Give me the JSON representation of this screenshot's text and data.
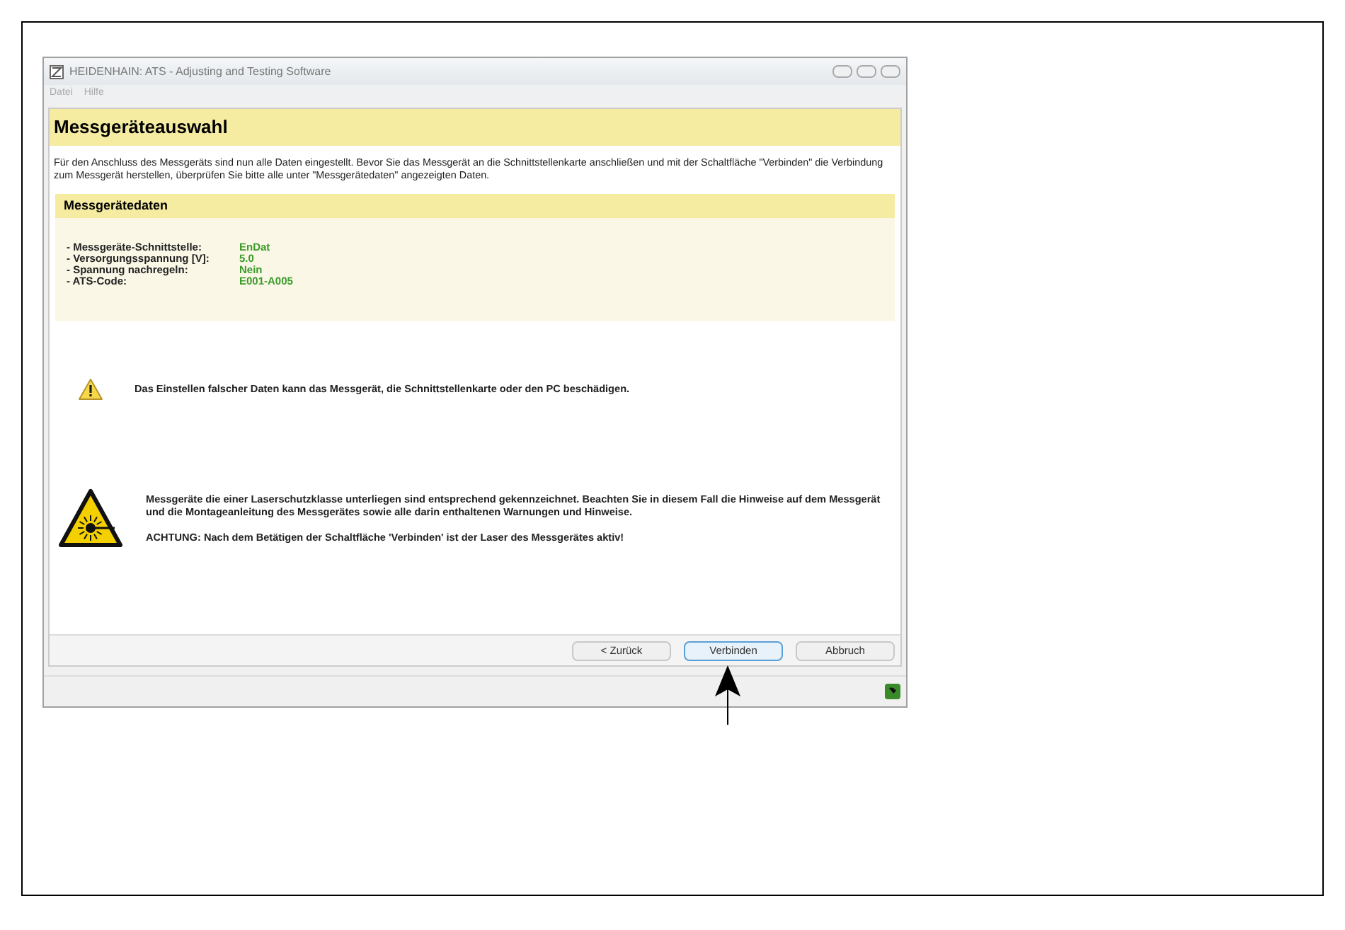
{
  "window": {
    "title": "HEIDENHAIN: ATS - Adjusting and Testing Software"
  },
  "menu": [
    "Datei",
    "Hilfe"
  ],
  "heading": "Messgeräteauswahl",
  "intro": "Für den Anschluss des Messgeräts sind nun alle Daten eingestellt. Bevor Sie das Messgerät an die Schnittstellenkarte anschließen und mit der Schaltfläche \"Verbinden\" die Verbindung zum Messgerät herstellen, überprüfen Sie bitte alle unter \"Messgerätedaten\" angezeigten Daten.",
  "device_data": {
    "title": "Messgerätedaten",
    "rows": [
      {
        "label": "- Messgeräte-Schnittstelle:",
        "value": "EnDat"
      },
      {
        "label": "- Versorgungsspannung [V]:",
        "value": "5.0"
      },
      {
        "label": "- Spannung nachregeln:",
        "value": "Nein"
      },
      {
        "label": "- ATS-Code:",
        "value": "E001-A005"
      }
    ]
  },
  "warnings": [
    {
      "kind": "caution",
      "paragraphs": [
        "Das Einstellen falscher Daten kann das Messgerät, die Schnittstellenkarte oder den PC beschädigen."
      ]
    },
    {
      "kind": "laser",
      "paragraphs": [
        "Messgeräte die einer Laserschutzklasse unterliegen sind entsprechend gekennzeichnet. Beachten Sie in diesem Fall die Hinweise auf dem Messgerät und die Montageanleitung des Messgerätes sowie alle darin enthaltenen Warnungen und Hinweise.",
        "ACHTUNG: Nach dem Betätigen der Schaltfläche 'Verbinden' ist der Laser des Messgerätes aktiv!"
      ]
    }
  ],
  "buttons": [
    {
      "label": "< Zurück",
      "focused": false
    },
    {
      "label": "Verbinden",
      "focused": true
    },
    {
      "label": "Abbruch",
      "focused": false
    }
  ]
}
